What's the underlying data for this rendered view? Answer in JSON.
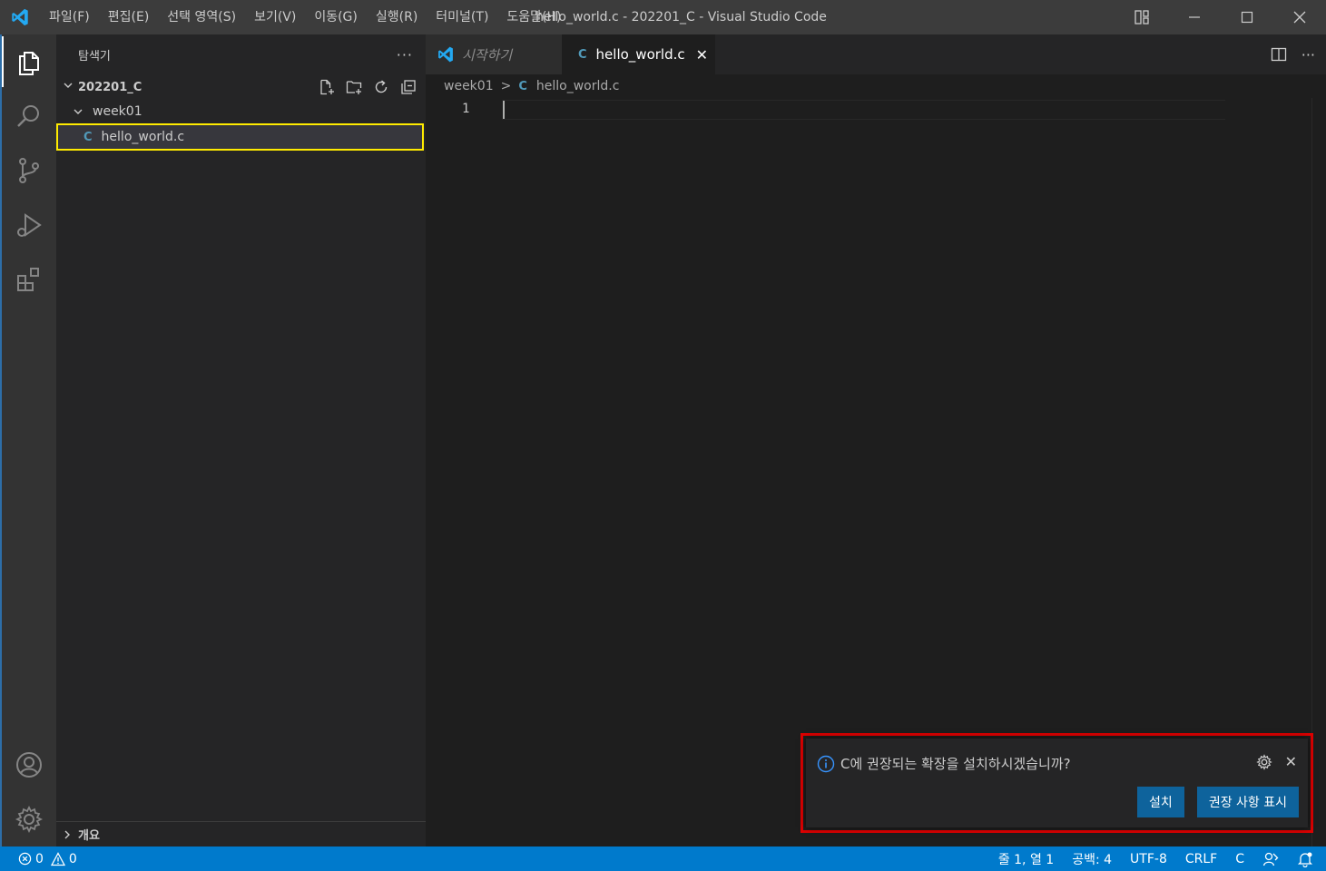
{
  "window": {
    "title": "hello_world.c - 202201_C - Visual Studio Code"
  },
  "menu": [
    "파일(F)",
    "편집(E)",
    "선택 영역(S)",
    "보기(V)",
    "이동(G)",
    "실행(R)",
    "터미널(T)",
    "도움말(H)"
  ],
  "sidebar": {
    "title": "탐색기",
    "more": "···",
    "folder": "202201_C",
    "subfolder": "week01",
    "file": "hello_world.c",
    "file_glyph": "C",
    "outline": "개요"
  },
  "tabs": [
    {
      "label": "시작하기"
    },
    {
      "label": "hello_world.c",
      "glyph": "C",
      "close": "✕"
    }
  ],
  "breadcrumb": {
    "folder": "week01",
    "sep": ">",
    "glyph": "C",
    "file": "hello_world.c"
  },
  "editor": {
    "line_number": "1"
  },
  "notification": {
    "message": "C에 권장되는 확장을 설치하시겠습니까?",
    "close": "✕",
    "install": "설치",
    "show_recommendations": "권장 사항 표시"
  },
  "statusbar": {
    "errors": "0",
    "warnings": "0",
    "position": "줄 1, 열 1",
    "spaces": "공백: 4",
    "encoding": "UTF-8",
    "eol": "CRLF",
    "language": "C"
  },
  "colors": {
    "accent": "#007acc",
    "highlight_border": "#ffeb00",
    "notification_border": "#e00000",
    "button": "#0e639c"
  }
}
